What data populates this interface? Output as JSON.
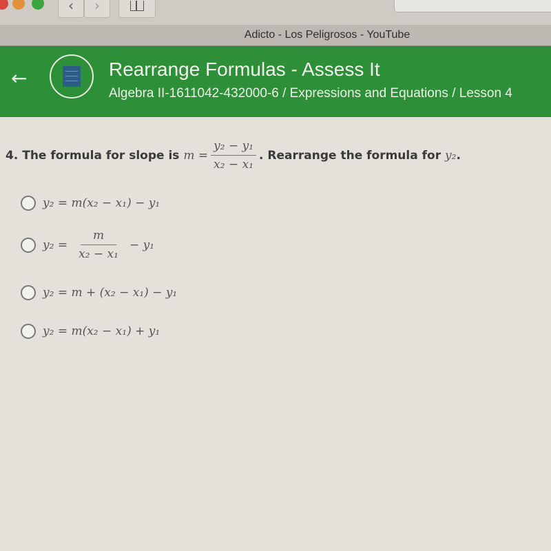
{
  "browser": {
    "back_glyph": "‹",
    "forward_glyph": "›",
    "tab_title": "Adicto - Los Peligrosos - YouTube"
  },
  "header": {
    "back_icon": "←",
    "title": "Rearrange Formulas - Assess It",
    "breadcrumb": "Algebra II-1611042-432000-6 / Expressions and Equations / Lesson 4",
    "accent_color": "#2d8f37"
  },
  "question": {
    "number": "4.",
    "text_before": "The formula for slope is",
    "lhs": "m =",
    "frac_num": "y₂ − y₁",
    "frac_den": "x₂ − x₁",
    "text_after": ". Rearrange the formula for",
    "target": "y₂",
    "end": "."
  },
  "options": [
    {
      "label": "y₂ = m(x₂ − x₁) − y₁",
      "selected": false
    },
    {
      "lhs": "y₂ =",
      "frac_num": "m",
      "frac_den": "x₂ − x₁",
      "rhs": "− y₁",
      "selected": false
    },
    {
      "label": "y₂ = m + (x₂ − x₁) − y₁",
      "selected": false
    },
    {
      "label": "y₂ = m(x₂ − x₁) + y₁",
      "selected": false
    }
  ]
}
